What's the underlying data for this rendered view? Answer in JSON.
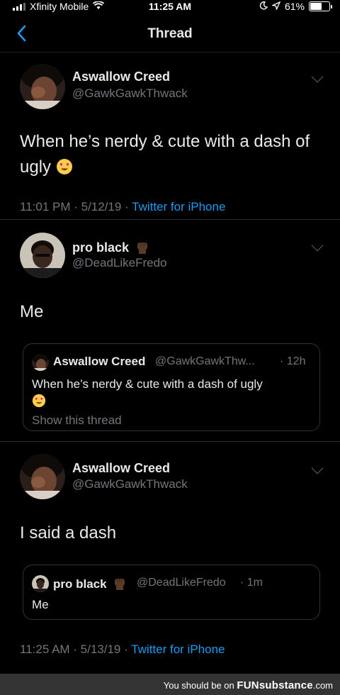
{
  "status_bar": {
    "carrier": "Xfinity Mobile",
    "time": "11:25 AM",
    "battery": "61%",
    "battery_level": 0.61
  },
  "nav": {
    "title": "Thread",
    "back_icon": "chevron-left-icon"
  },
  "tweets": [
    {
      "name": "Aswallow Creed",
      "handle": "@GawkGawkThwack",
      "text": "When he’s nerdy & cute with a dash of ugly",
      "emoji": "heart-eyes-emoji",
      "time": "11:01 PM · 5/12/19 ·",
      "source": "Twitter for iPhone"
    },
    {
      "name": "pro black",
      "name_emoji": "raised-fist-emoji",
      "handle": "@DeadLikeFredo",
      "text": "Me",
      "quote": {
        "name": "Aswallow Creed",
        "handle": "@GawkGawkThw...",
        "age": "· 12h",
        "text": "When he’s nerdy & cute with a dash of ugly",
        "emoji": "heart-eyes-emoji",
        "show_thread": "Show this thread"
      }
    },
    {
      "name": "Aswallow Creed",
      "handle": "@GawkGawkThwack",
      "text": "I said a dash",
      "quote": {
        "name": "pro black",
        "name_emoji": "raised-fist-emoji",
        "handle": "@DeadLikeFredo",
        "age": "· 1m",
        "text": "Me"
      },
      "time": "11:25 AM · 5/13/19 ·",
      "source": "Twitter for iPhone"
    }
  ],
  "footer": {
    "prefix": "You should be on",
    "brand": "FUNsubstance",
    "suffix": ".com"
  },
  "colors": {
    "background": "#000000",
    "accent": "#1d9bf0",
    "secondary_text": "#71767b"
  }
}
